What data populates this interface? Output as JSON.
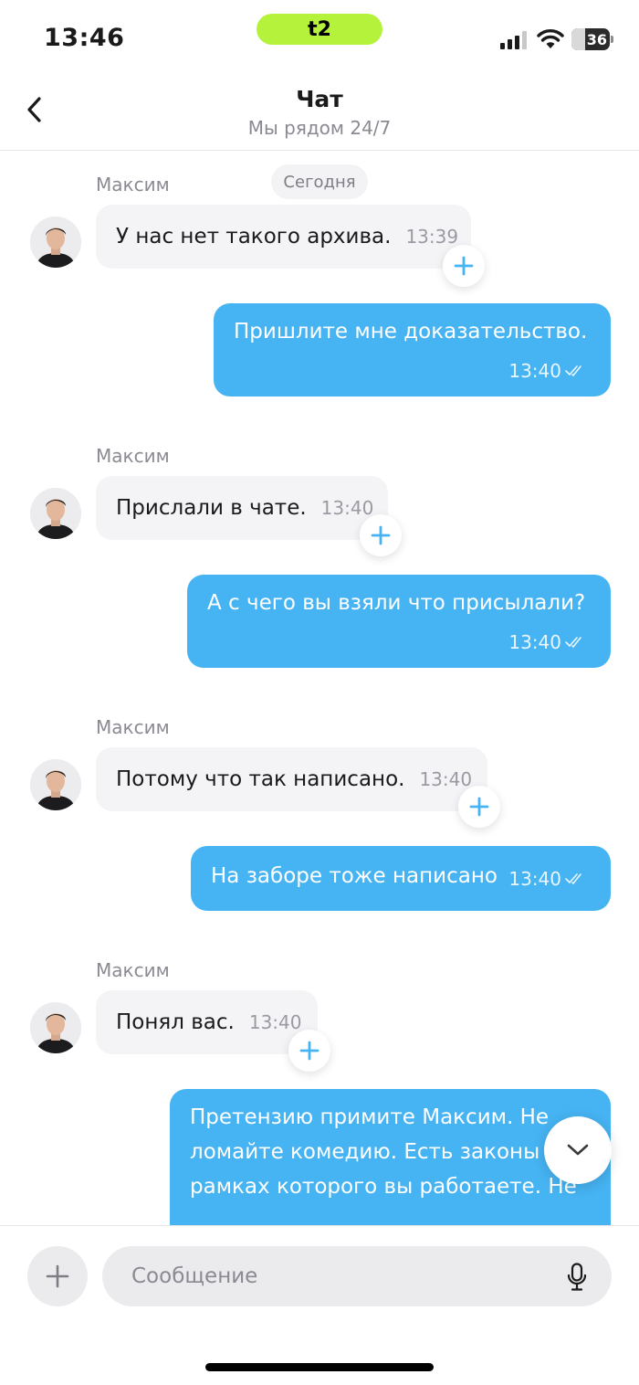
{
  "status_bar": {
    "time": "13:46",
    "carrier_logo": "t2",
    "battery_percent": 36,
    "battery_label": "36",
    "carrier_pill_color": "#b5f23b",
    "icons": [
      "signal-icon",
      "wifi-icon",
      "battery-icon"
    ]
  },
  "header": {
    "back_icon": "chevron-left-icon",
    "title": "Чат",
    "subtitle": "Мы рядом 24/7"
  },
  "chat": {
    "date_label": "Сегодня",
    "colors": {
      "incoming_bubble": "#f4f4f7",
      "outgoing_bubble": "#46b3f2",
      "accent": "#46b3f2"
    },
    "incoming": [
      {
        "sender": "Максим",
        "text": "У нас нет такого архива.",
        "time": "13:39"
      },
      {
        "sender": "Максим",
        "text": "Прислали в чате.",
        "time": "13:40"
      },
      {
        "sender": "Максим",
        "text": "Потому что так написано.",
        "time": "13:40"
      },
      {
        "sender": "Максим",
        "text": "Понял вас.",
        "time": "13:40"
      }
    ],
    "outgoing": [
      {
        "text": "Пришлите мне доказательство.",
        "time": "13:40",
        "status": "read-check-icon"
      },
      {
        "text": "А с чего вы взяли что присылали?",
        "time": "13:40",
        "status": "read-check-icon"
      },
      {
        "text": "На заборе тоже написано",
        "time": "13:40",
        "status": "read-check-icon"
      }
    ],
    "last_outgoing_lines": [
      "Претензию примите Максим. Не",
      "ломайте комедию. Есть законы",
      "рамках которого вы работаете. Не"
    ]
  },
  "composer": {
    "placeholder": "Сообщение",
    "value": "",
    "attach_icon": "plus-icon",
    "mic_icon": "microphone-icon",
    "scroll_icon": "chevron-down-icon"
  }
}
